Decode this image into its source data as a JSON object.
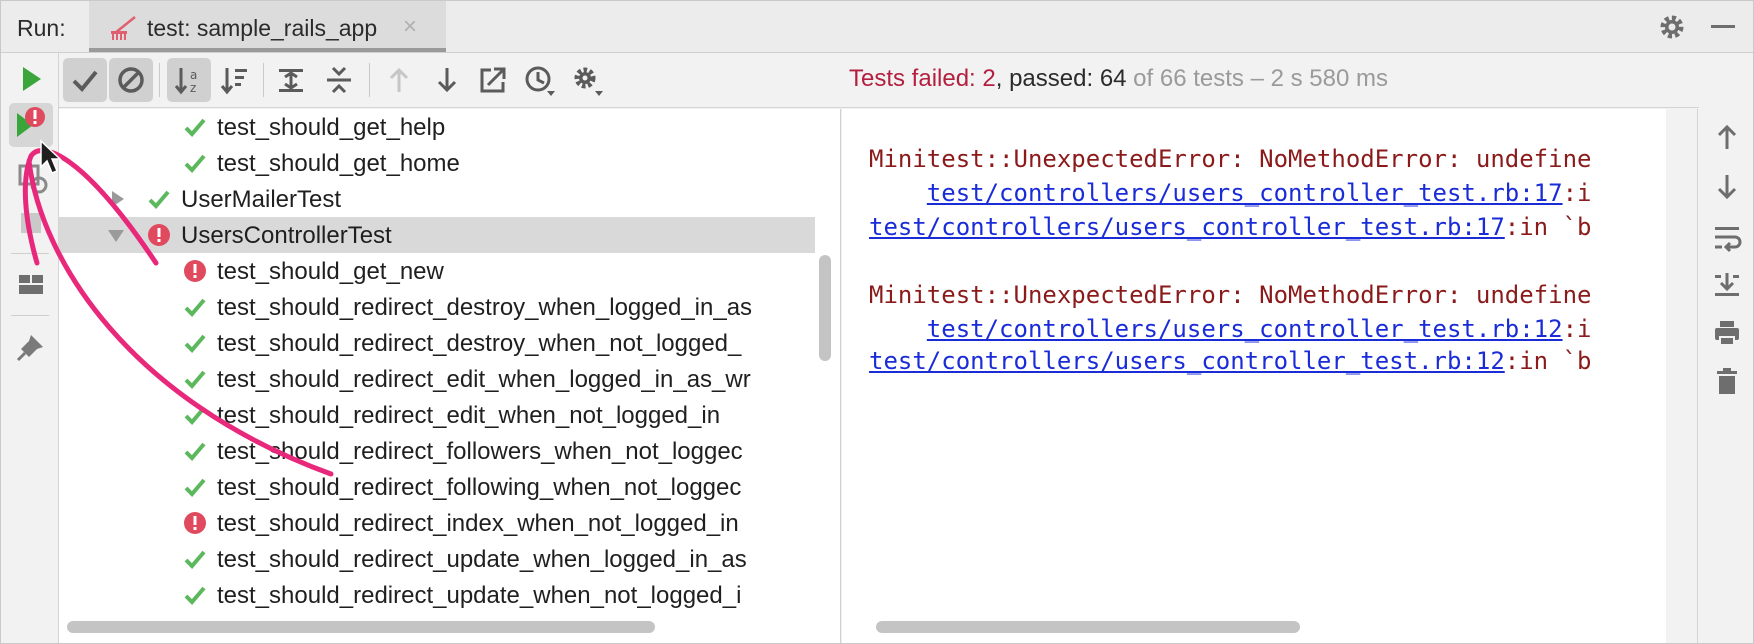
{
  "titlebar": {
    "run_label": "Run:",
    "tab_title": "test: sample_rails_app",
    "tab_close": "×"
  },
  "status": {
    "failed_label": "Tests failed: 2",
    "passed_label": ", passed: 64",
    "total_label": " of 66 tests – 2 s 580 ms"
  },
  "tree": {
    "rows": [
      {
        "label": "test_should_get_help",
        "status": "passed"
      },
      {
        "label": "test_should_get_home",
        "status": "passed"
      },
      {
        "label": "UserMailerTest",
        "status": "passed"
      },
      {
        "label": "UsersControllerTest",
        "status": "failed"
      },
      {
        "label": "test_should_get_new",
        "status": "failed"
      },
      {
        "label": "test_should_redirect_destroy_when_logged_in_as",
        "status": "passed"
      },
      {
        "label": "test_should_redirect_destroy_when_not_logged_",
        "status": "passed"
      },
      {
        "label": "test_should_redirect_edit_when_logged_in_as_wr",
        "status": "passed"
      },
      {
        "label": "test_should_redirect_edit_when_not_logged_in",
        "status": "passed"
      },
      {
        "label": "test_should_redirect_followers_when_not_loggec",
        "status": "passed"
      },
      {
        "label": "test_should_redirect_following_when_not_loggec",
        "status": "passed"
      },
      {
        "label": "test_should_redirect_index_when_not_logged_in",
        "status": "failed"
      },
      {
        "label": "test_should_redirect_update_when_logged_in_as",
        "status": "passed"
      },
      {
        "label": "test_should_redirect_update_when_not_logged_i",
        "status": "passed"
      }
    ]
  },
  "console": {
    "lines": [
      {
        "prefix": "Minitest::UnexpectedError: NoMethodError: undefine",
        "link": "",
        "suffix": ""
      },
      {
        "prefix": "    ",
        "link": "test/controllers/users_controller_test.rb:17",
        "suffix": ":i"
      },
      {
        "prefix": "",
        "link": "test/controllers/users_controller_test.rb:17",
        "suffix": ":in `b"
      },
      {
        "prefix": "Minitest::UnexpectedError: NoMethodError: undefine",
        "link": "",
        "suffix": ""
      },
      {
        "prefix": "    ",
        "link": "test/controllers/users_controller_test.rb:12",
        "suffix": ":i"
      },
      {
        "prefix": "",
        "link": "test/controllers/users_controller_test.rb:12",
        "suffix": ":in `b"
      }
    ]
  },
  "colors": {
    "passed": "#5cb85c",
    "failed": "#e04a5f",
    "annotation": "#e8287a",
    "run_green": "#3aa53a"
  },
  "icons": {
    "left_toolbar": [
      "play-icon",
      "rerun-failed-icon",
      "toggle-auto-test-icon",
      "stop-icon",
      "layout-icon",
      "pin-icon"
    ],
    "top_toolbar": [
      "show-passed-icon",
      "show-ignored-icon",
      "sort-alphabetically-icon",
      "sort-by-duration-icon",
      "expand-all-icon",
      "collapse-all-icon",
      "previous-failed-icon",
      "next-failed-icon",
      "export-icon",
      "history-icon",
      "settings-icon"
    ],
    "right_toolbar": [
      "up-arrow-icon",
      "down-arrow-icon",
      "soft-wrap-icon",
      "scroll-to-end-icon",
      "print-icon",
      "trash-icon"
    ]
  }
}
